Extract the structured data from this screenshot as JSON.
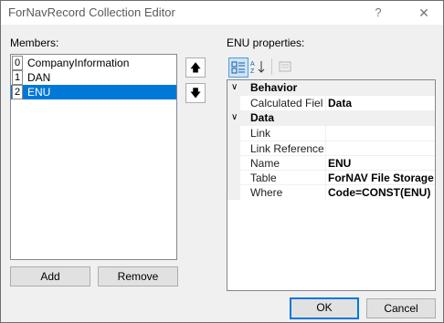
{
  "window": {
    "title": "ForNavRecord Collection Editor",
    "help_glyph": "?",
    "close_glyph": "✕"
  },
  "members": {
    "label": "Members:",
    "items": [
      {
        "index": "0",
        "name": "CompanyInformation",
        "selected": false
      },
      {
        "index": "1",
        "name": "DAN",
        "selected": false
      },
      {
        "index": "2",
        "name": "ENU",
        "selected": true
      }
    ],
    "move_up_glyph": "🡅",
    "move_down_glyph": "🡇",
    "add_label": "Add",
    "remove_label": "Remove"
  },
  "properties": {
    "label": "ENU properties:",
    "categories": [
      {
        "name": "Behavior",
        "rows": [
          {
            "name": "Calculated Fields",
            "value": "Data"
          }
        ]
      },
      {
        "name": "Data",
        "rows": [
          {
            "name": "Link",
            "value": ""
          },
          {
            "name": "Link Reference",
            "value": ""
          },
          {
            "name": "Name",
            "value": "ENU"
          },
          {
            "name": "Table",
            "value": "ForNAV File Storage"
          },
          {
            "name": "Where",
            "value": "Code=CONST(ENU)"
          }
        ]
      }
    ],
    "collapse_glyph": "∨"
  },
  "footer": {
    "ok_label": "OK",
    "cancel_label": "Cancel"
  },
  "colors": {
    "selection": "#0078d7",
    "window_bg": "#f0f0f0"
  }
}
